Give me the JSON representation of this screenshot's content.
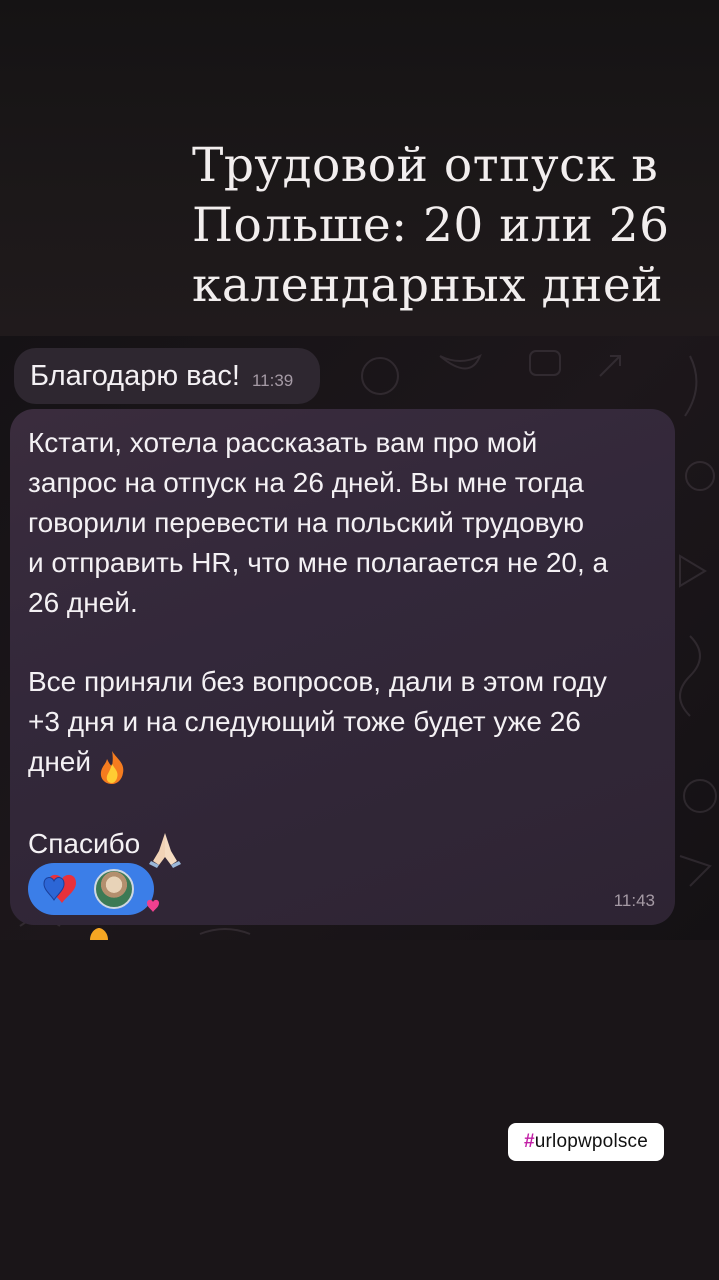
{
  "story": {
    "title": "Трудовой отпуск в Польше: 20 или 26 календарных дней",
    "hashtag_symbol": "#",
    "hashtag_text": "urlopwpolsce"
  },
  "chat": {
    "message1": {
      "text": "Благодарю вас!",
      "time": "11:39"
    },
    "message2": {
      "paragraph1": "Кстати, хотела рассказать вам про мой\nзапрос на отпуск на 26 дней. Вы мне тогда\nговорили перевести на польский трудовую\nи отправить HR, что мне полагается не 20, а\n26 дней.",
      "paragraph2": "Все приняли без вопросов, дали в этом году\n+3 дня и на следующий тоже будет уже 26\nдней",
      "paragraph3": "Спасибо",
      "time": "11:43",
      "reactions": [
        "heart-emoji",
        "avatar"
      ]
    }
  },
  "colors": {
    "bubble": "#33283a",
    "reaction_pill": "#3b7ee8",
    "hashtag_accent": "#c21fa6"
  }
}
